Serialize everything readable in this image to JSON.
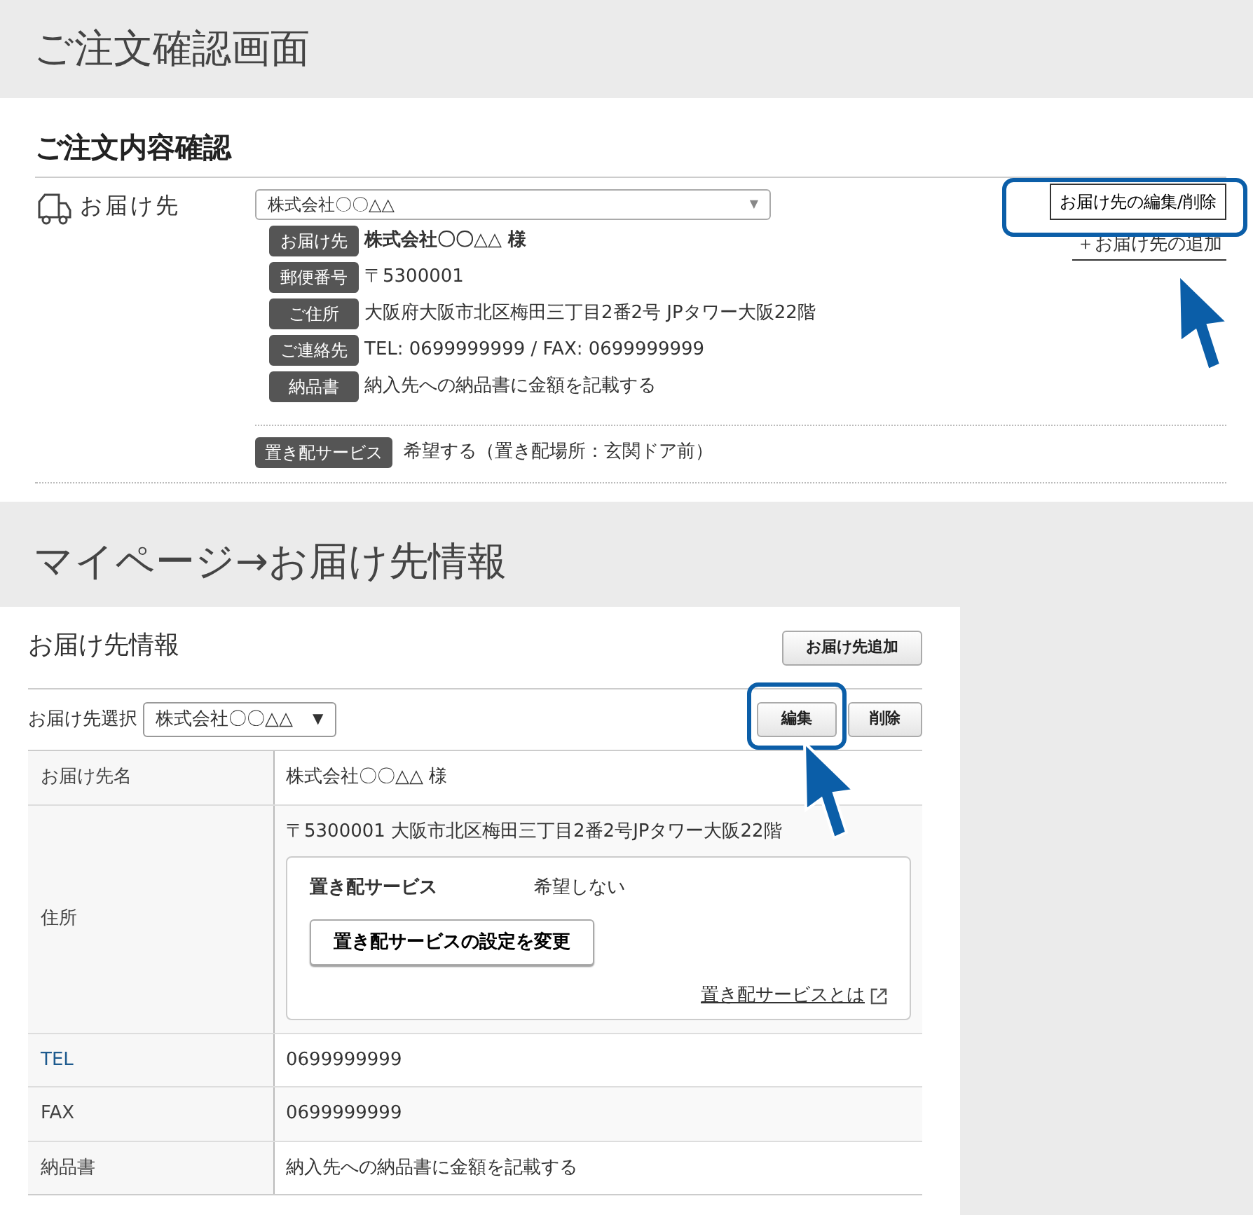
{
  "order_heading": "ご注文確認画面",
  "order_confirm": {
    "title": "ご注文内容確認",
    "delivery_label": "お届け先",
    "select_value": "株式会社〇〇△△",
    "select_caret": "▼",
    "details": [
      {
        "tag": "お届け先",
        "value": "株式会社〇〇△△ 様",
        "bold": true
      },
      {
        "tag": "郵便番号",
        "value": "〒5300001",
        "bold": false
      },
      {
        "tag": "ご住所",
        "value": "大阪府大阪市北区梅田三丁目2番2号 JPタワー大阪22階",
        "bold": false
      },
      {
        "tag": "ご連絡先",
        "value": " TEL: 0699999999 /  FAX: 0699999999",
        "bold": false
      },
      {
        "tag": "納品書",
        "value": "納入先への納品書に金額を記載する",
        "bold": false
      }
    ],
    "edit_button": "お届け先の編集/削除",
    "add_link": "＋お届け先の追加",
    "okihai": {
      "tag": "置き配サービス",
      "value": "希望する（置き配場所：玄関ドア前）"
    }
  },
  "mypage_heading": "マイページ→お届け先情報",
  "address_book": {
    "title": "お届け先情報",
    "add_button": "お届け先追加",
    "select_label": "お届け先選択",
    "select_value": "株式会社〇〇△△",
    "select_caret": "▼",
    "edit_button": "編集",
    "delete_button": "削除",
    "rows": [
      {
        "label": "お届け先名",
        "value": "株式会社〇〇△△ 様",
        "linked": false
      },
      {
        "label": "住所",
        "value": "〒5300001 大阪市北区梅田三丁目2番2号JPタワー大阪22階",
        "linked": false,
        "okihai": {
          "label": "置き配サービス",
          "status": "希望しない",
          "button": "置き配サービスの設定を変更",
          "link": "置き配サービスとは"
        }
      },
      {
        "label": "TEL",
        "value": "0699999999",
        "linked": true
      },
      {
        "label": "FAX",
        "value": "0699999999",
        "linked": false
      },
      {
        "label": "納品書",
        "value": "納入先への納品書に金額を記載する",
        "linked": false
      }
    ]
  }
}
